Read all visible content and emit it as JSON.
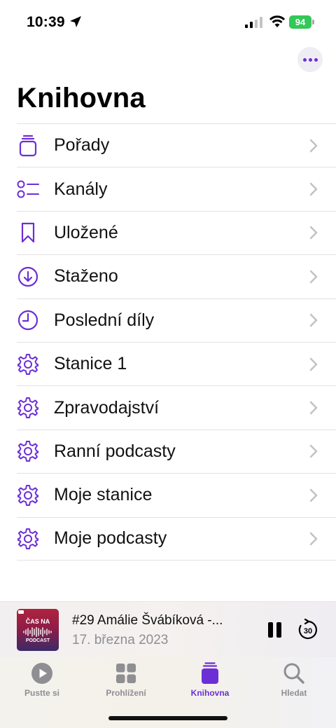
{
  "status_bar": {
    "time": "10:39",
    "battery": "94",
    "icons": [
      "location-arrow-icon",
      "cellular-signal-icon",
      "wifi-icon",
      "battery-icon"
    ]
  },
  "header": {
    "more_icon": "ellipsis-icon",
    "title": "Knihovna"
  },
  "library": {
    "items": [
      {
        "label": "Pořady",
        "icon": "shows-icon"
      },
      {
        "label": "Kanály",
        "icon": "channels-icon"
      },
      {
        "label": "Uložené",
        "icon": "bookmark-icon"
      },
      {
        "label": "Staženo",
        "icon": "download-icon"
      },
      {
        "label": "Poslední díly",
        "icon": "clock-icon"
      },
      {
        "label": "Stanice 1",
        "icon": "gear-icon"
      },
      {
        "label": "Zpravodajství",
        "icon": "gear-icon"
      },
      {
        "label": "Ranní podcasty",
        "icon": "gear-icon"
      },
      {
        "label": "Moje stanice",
        "icon": "gear-icon"
      },
      {
        "label": "Moje podcasty",
        "icon": "gear-icon"
      }
    ]
  },
  "now_playing": {
    "artwork_top": "ČAS NA",
    "artwork_bottom": "PODCAST",
    "title": "#29 Amálie Švábíková -...",
    "date": "17. března 2023",
    "skip_label": "30"
  },
  "tab_bar": {
    "tabs": [
      {
        "label": "Pustte si",
        "icon": "play-circle-icon"
      },
      {
        "label": "Prohlížení",
        "icon": "grid-icon"
      },
      {
        "label": "Knihovna",
        "icon": "library-icon",
        "active": true
      },
      {
        "label": "Hledat",
        "icon": "search-icon"
      }
    ]
  },
  "colors": {
    "accent": "#6c2fd6",
    "inactive": "#8e8e93",
    "battery": "#34c759"
  }
}
